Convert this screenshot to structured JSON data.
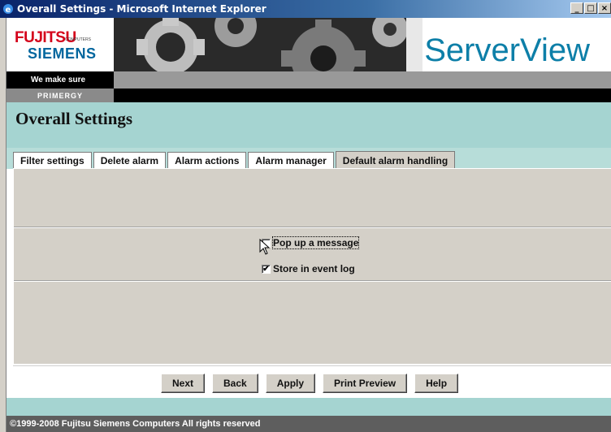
{
  "window": {
    "title": "Overall Settings - Microsoft Internet Explorer",
    "controls": [
      "_",
      "□",
      "×"
    ]
  },
  "header": {
    "logo_fujitsu": "FUJITSU",
    "logo_computers": "COMPUTERS",
    "logo_siemens": "SIEMENS",
    "tagline": "We make sure",
    "product_line": "PRIMERGY",
    "brand": "ServerView"
  },
  "page": {
    "title": "Overall Settings"
  },
  "tabs": [
    {
      "label": "Filter settings",
      "active": false
    },
    {
      "label": "Delete alarm",
      "active": false
    },
    {
      "label": "Alarm actions",
      "active": false
    },
    {
      "label": "Alarm manager",
      "active": false
    },
    {
      "label": "Default alarm handling",
      "active": true
    }
  ],
  "options": {
    "popup": {
      "label": "Pop up a message",
      "checked": false
    },
    "eventlog": {
      "label": "Store in event log",
      "checked": true
    }
  },
  "buttons": {
    "next": "Next",
    "back": "Back",
    "apply": "Apply",
    "print_preview": "Print Preview",
    "help": "Help"
  },
  "footer": {
    "copyright": "©1999-2008  Fujitsu Siemens Computers  All rights reserved"
  },
  "colors": {
    "teal": "#a5d4d1",
    "brand_blue": "#0d7fa8",
    "fujitsu_red": "#d4001a",
    "siemens_blue": "#00669e"
  }
}
